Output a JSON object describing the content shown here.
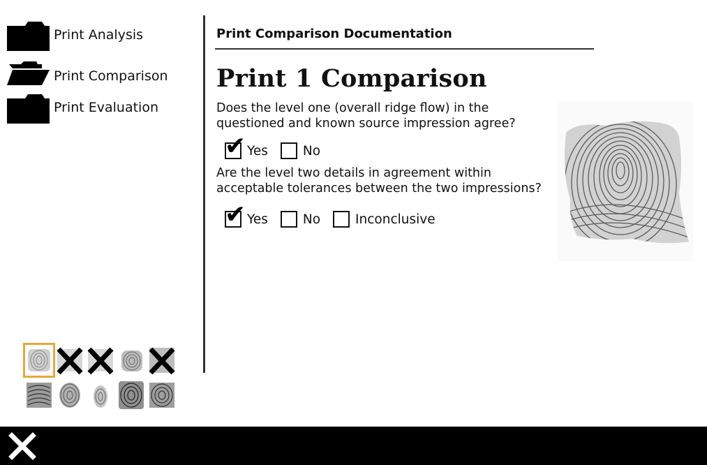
{
  "sidebar": {
    "items": [
      {
        "label": "Print Analysis",
        "icon": "folder-closed-icon"
      },
      {
        "label": "Print Comparison",
        "icon": "folder-open-icon"
      },
      {
        "label": "Print Evaluation",
        "icon": "folder-closed-icon"
      }
    ],
    "thumbnails": [
      {
        "state": "selected",
        "icon": "fingerprint-icon"
      },
      {
        "state": "rejected",
        "icon": "x-mark-icon"
      },
      {
        "state": "rejected",
        "icon": "x-mark-icon"
      },
      {
        "state": "normal",
        "icon": "fingerprint-icon"
      },
      {
        "state": "rejected",
        "icon": "x-mark-icon"
      },
      {
        "state": "normal",
        "icon": "fingerprint-icon"
      },
      {
        "state": "normal",
        "icon": "fingerprint-icon"
      },
      {
        "state": "normal",
        "icon": "fingerprint-icon"
      },
      {
        "state": "normal",
        "icon": "fingerprint-icon"
      },
      {
        "state": "normal",
        "icon": "fingerprint-icon"
      }
    ],
    "selected_color": "#e9a83a"
  },
  "main": {
    "section_title": "Print Comparison Documentation",
    "heading": "Print 1 Comparison",
    "questions": [
      {
        "text": "Does the level one (overall ridge flow)  in the questioned and known source impression agree?",
        "options": [
          {
            "label": "Yes",
            "checked": true
          },
          {
            "label": "No",
            "checked": false
          }
        ]
      },
      {
        "text": "Are the level two details in agreement within acceptable tolerances between the two impressions?",
        "options": [
          {
            "label": "Yes",
            "checked": true
          },
          {
            "label": "No",
            "checked": false
          },
          {
            "label": "Inconclusive",
            "checked": false
          }
        ]
      }
    ],
    "check_glyph": "✔"
  },
  "footer": {
    "close_icon": "close-icon",
    "bar_color": "#000000"
  }
}
